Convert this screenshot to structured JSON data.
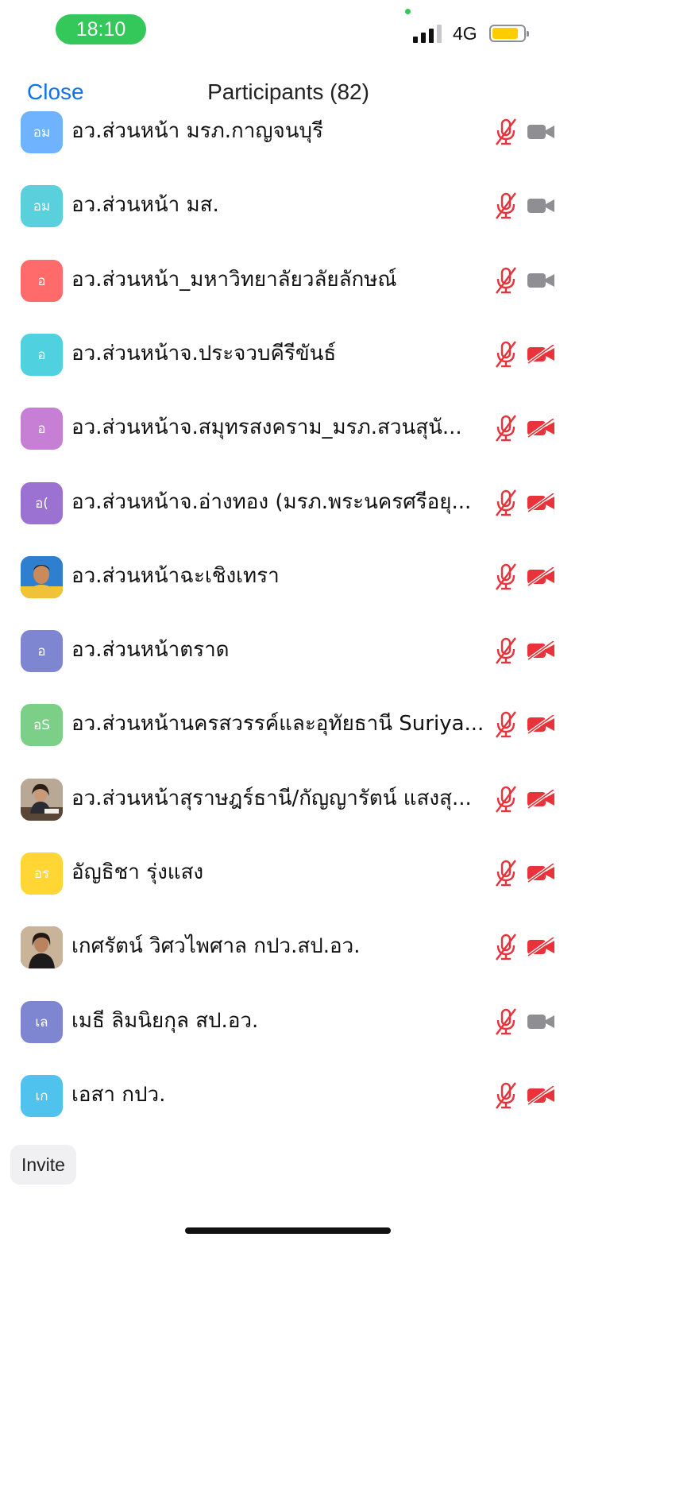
{
  "status_bar": {
    "time": "18:10",
    "network": "4G",
    "signal_bars_active": 3,
    "signal_bars_total": 4,
    "battery_level": 0.85,
    "colors": {
      "time_pill": "#34c759",
      "battery": "#ffcc00"
    }
  },
  "header": {
    "close_label": "Close",
    "title": "Participants (82)"
  },
  "participants": [
    {
      "initials": "อม",
      "avatar_color": "#6fb3ff",
      "name": "อว.ส่วนหน้า มรภ.กาญจนบุรี",
      "muted": true,
      "video": "off-gray"
    },
    {
      "initials": "อม",
      "avatar_color": "#5bd0dd",
      "name": "อว.ส่วนหน้า มส.",
      "muted": true,
      "video": "off-gray"
    },
    {
      "initials": "อ",
      "avatar_color": "#ff6b6b",
      "name": "อว.ส่วนหน้า_มหาวิทยาลัยวลัยลักษณ์",
      "muted": true,
      "video": "off-gray"
    },
    {
      "initials": "อ",
      "avatar_color": "#4fd1df",
      "name": "อว.ส่วนหน้าจ.ประจวบคีรีขันธ์",
      "muted": true,
      "video": "off-red"
    },
    {
      "initials": "อ",
      "avatar_color": "#c77fd6",
      "name": "อว.ส่วนหน้าจ.สมุทรสงคราม_มรภ.สวนสุนั...",
      "muted": true,
      "video": "off-red"
    },
    {
      "initials": "อ(",
      "avatar_color": "#9b72d1",
      "name": "อว.ส่วนหน้าจ.อ่างทอง (มรภ.พระนครศรีอยุ...",
      "muted": true,
      "video": "off-red"
    },
    {
      "initials": "",
      "avatar_color": "#3a8fd8",
      "name": "อว.ส่วนหน้าฉะเชิงเทรา",
      "muted": true,
      "video": "off-red",
      "photo": "man-yellow-shirt"
    },
    {
      "initials": "อ",
      "avatar_color": "#7e86d2",
      "name": "อว.ส่วนหน้าตราด",
      "muted": true,
      "video": "off-red"
    },
    {
      "initials": "อS",
      "avatar_color": "#7ccf86",
      "name": "อว.ส่วนหน้านครสวรรค์และอุทัยธานี Suriya...",
      "muted": true,
      "video": "off-red"
    },
    {
      "initials": "",
      "avatar_color": "#8a6d5a",
      "name": "อว.ส่วนหน้าสุราษฎร์ธานี/กัญญารัตน์ แสงสุ...",
      "muted": true,
      "video": "off-red",
      "photo": "woman-at-desk"
    },
    {
      "initials": "อร",
      "avatar_color": "#ffd633",
      "name": "อัญธิชา รุ่งแสง",
      "muted": true,
      "video": "off-red"
    },
    {
      "initials": "",
      "avatar_color": "#6b5140",
      "name": "เกศรัตน์ วิศวไพศาล กปว.สป.อว.",
      "muted": true,
      "video": "off-red",
      "photo": "woman-portrait"
    },
    {
      "initials": "เล",
      "avatar_color": "#7e86d2",
      "name": "เมธี ลิมนิยกุล สป.อว.",
      "muted": true,
      "video": "off-gray"
    },
    {
      "initials": "เก",
      "avatar_color": "#4fc3ee",
      "name": "เอสา กปว.",
      "muted": true,
      "video": "off-red"
    }
  ],
  "footer": {
    "invite_label": "Invite"
  },
  "colors": {
    "accent": "#0e72ed",
    "muted_red": "#e8333a",
    "video_gray": "#8e8e93"
  }
}
